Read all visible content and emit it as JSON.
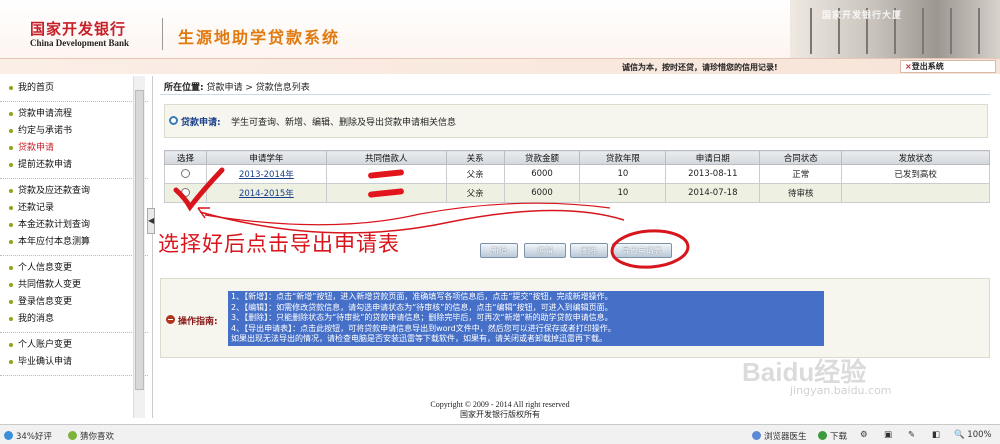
{
  "header": {
    "bank_name_cn": "国家开发银行",
    "bank_name_en": "China Development Bank",
    "system_title": "生源地助学贷款系统",
    "building_sign": "国家开发银行大厦"
  },
  "notice": {
    "text": "诚信为本，按时还贷，请珍惜您的信用记录!",
    "logout": "登出系统"
  },
  "sidebar": {
    "groups": [
      [
        {
          "label": "我的首页"
        }
      ],
      [
        {
          "label": "贷款申请流程"
        },
        {
          "label": "约定与承诺书"
        },
        {
          "label": "贷款申请",
          "active": true
        },
        {
          "label": "提前还款申请"
        }
      ],
      [
        {
          "label": "贷款及应还款查询"
        },
        {
          "label": "还款记录"
        },
        {
          "label": "本金还款计划查询"
        },
        {
          "label": "本年应付本息测算"
        }
      ],
      [
        {
          "label": "个人信息变更"
        },
        {
          "label": "共同借款人变更"
        },
        {
          "label": "登录信息变更"
        },
        {
          "label": "我的消息"
        }
      ],
      [
        {
          "label": "个人账户变更"
        },
        {
          "label": "毕业确认申请"
        }
      ]
    ]
  },
  "breadcrumb": {
    "prefix": "所在位置:",
    "path": "贷款申请 > 贷款信息列表"
  },
  "info": {
    "label": "贷款申请:",
    "text": "学生可查询、新增、编辑、删除及导出贷款申请相关信息"
  },
  "table": {
    "headers": [
      "选择",
      "申请学年",
      "共同借款人",
      "关系",
      "贷款金额",
      "贷款年限",
      "申请日期",
      "合同状态",
      "发放状态"
    ],
    "rows": [
      {
        "year": "2013-2014年",
        "relation": "父亲",
        "amount": "6000",
        "term": "10",
        "date": "2013-08-11",
        "contract": "正常",
        "release": "已发到高校"
      },
      {
        "year": "2014-2015年",
        "relation": "父亲",
        "amount": "6000",
        "term": "10",
        "date": "2014-07-18",
        "contract": "待审核",
        "release": ""
      }
    ]
  },
  "buttons": {
    "add": "新增",
    "edit": "编辑",
    "delete": "删除",
    "export": "导出申请表"
  },
  "guide": {
    "label": "操作指南:",
    "lines": [
      "1、【新增】：点击“新增”按钮，进入新增贷款页面，准确填写各项信息后，点击“提交”按钮，完成新增操作。",
      "2、【编辑】：如需修改贷款信息，请勾选申请状态为“待审核”的信息，点击“编辑”按钮，可进入到编辑页面。",
      "3、【删除】：只能删除状态为“待审批”的贷款申请信息；删除完毕后，可再次“新增”新的助学贷款申请信息。",
      "4、【导出申请表】：点击此按钮，可将贷款申请信息导出到word文件中，然后您可以进行保存或者打印操作。",
      "   如果出现无法导出的情况，请检查电脑是否安装迅雷等下载软件，如果有，请关闭或者卸载掉迅雷再下载。"
    ]
  },
  "footer": {
    "copyright": "Copyright © 2009 - 2014 All right reserved",
    "owner": "国家开发银行版权所有"
  },
  "annotation": {
    "text": "选择好后点击导出申请表"
  },
  "watermark": {
    "main": "Baidu经验",
    "sub": "jingyan.baidu.com"
  },
  "statusbar": {
    "rating": "34%好评",
    "guess": "猜你喜欢",
    "doctor": "浏览器医生",
    "download": "下载",
    "zoom": "100%"
  },
  "colors": {
    "brand_red": "#c8202a",
    "title_orange": "#e07a10",
    "annotation_red": "#d8141c",
    "guide_highlight": "#4670c8"
  }
}
